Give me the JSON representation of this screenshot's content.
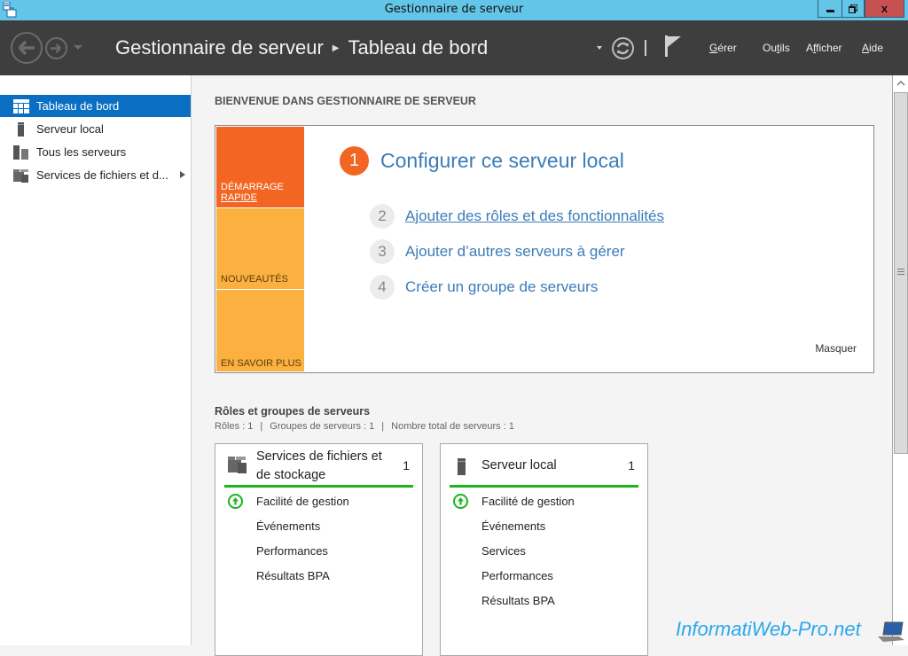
{
  "window": {
    "title": "Gestionnaire de serveur",
    "app_icon": "server-manager-icon",
    "controls": [
      "minimize",
      "restore",
      "close"
    ]
  },
  "header": {
    "breadcrumb": [
      "Gestionnaire de serveur",
      "Tableau de bord"
    ],
    "menu": [
      {
        "label": "Gérer",
        "accesskey": "G"
      },
      {
        "label": "Outils",
        "accesskey": "t"
      },
      {
        "label": "Afficher",
        "accesskey": "f"
      },
      {
        "label": "Aide",
        "accesskey": "A"
      }
    ]
  },
  "sidebar": {
    "items": [
      {
        "label": "Tableau de bord",
        "icon": "dashboard-icon",
        "active": true
      },
      {
        "label": "Serveur local",
        "icon": "server-icon",
        "active": false
      },
      {
        "label": "Tous les serveurs",
        "icon": "servers-icon",
        "active": false
      },
      {
        "label": "Services de fichiers et d...",
        "icon": "file-services-icon",
        "active": false,
        "expandable": true
      }
    ]
  },
  "main": {
    "welcome_title": "BIENVENUE DANS GESTIONNAIRE DE SERVEUR",
    "quickstart": {
      "tabs": [
        {
          "line1": "DÉMARRAGE",
          "line2": "RAPIDE"
        },
        {
          "line1": "NOUVEAUTÉS"
        },
        {
          "line1": "EN SAVOIR PLUS"
        }
      ],
      "steps": [
        {
          "num": "1",
          "label": "Configurer ce serveur local"
        },
        {
          "num": "2",
          "label": "Ajouter des rôles et des fonctionnalités"
        },
        {
          "num": "3",
          "label": "Ajouter d’autres serveurs à gérer"
        },
        {
          "num": "4",
          "label": "Créer un groupe de serveurs"
        }
      ],
      "hide_label": "Masquer"
    },
    "roles": {
      "title": "Rôles et groupes de serveurs",
      "stats": [
        "Rôles : 1",
        "Groupes de serveurs : 1",
        "Nombre total de serveurs : 1"
      ],
      "stat_sep": "|",
      "tiles": [
        {
          "title_line1": "Services de fichiers et",
          "title_line2": "de stockage",
          "count": "1",
          "status_color": "#1cb51c",
          "rows": [
            "Facilité de gestion",
            "Événements",
            "Performances",
            "Résultats BPA"
          ]
        },
        {
          "title_line1": "Serveur local",
          "count": "1",
          "status_color": "#1cb51c",
          "rows": [
            "Facilité de gestion",
            "Événements",
            "Services",
            "Performances",
            "Résultats BPA"
          ]
        }
      ]
    }
  },
  "watermark": "InformatiWeb-Pro.net",
  "colors": {
    "titlebar": "#63c5e8",
    "header": "#3e3e3e",
    "accent": "#0a6fc2",
    "quickstart_orange": "#f26522",
    "quickstart_amber": "#fbb040",
    "link": "#3b7cb8",
    "status_green": "#1cb51c"
  }
}
